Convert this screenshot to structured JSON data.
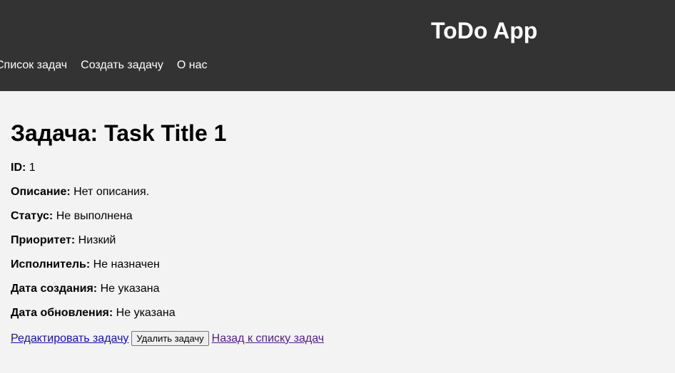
{
  "header": {
    "title": "ToDo App",
    "nav": [
      {
        "label": "Список задач"
      },
      {
        "label": "Создать задачу"
      },
      {
        "label": "О нас"
      }
    ]
  },
  "task": {
    "heading": "Задача: Task Title 1",
    "fields": [
      {
        "label": "ID:",
        "value": "1"
      },
      {
        "label": "Описание:",
        "value": "Нет описания."
      },
      {
        "label": "Статус:",
        "value": "Не выполнена"
      },
      {
        "label": "Приоритет:",
        "value": "Низкий"
      },
      {
        "label": "Исполнитель:",
        "value": "Не назначен"
      },
      {
        "label": "Дата создания:",
        "value": "Не указана"
      },
      {
        "label": "Дата обновления:",
        "value": "Не указана"
      }
    ]
  },
  "actions": {
    "edit_label": "Редактировать задачу",
    "delete_label": "Удалить задачу",
    "back_label": "Назад к списку задач"
  }
}
